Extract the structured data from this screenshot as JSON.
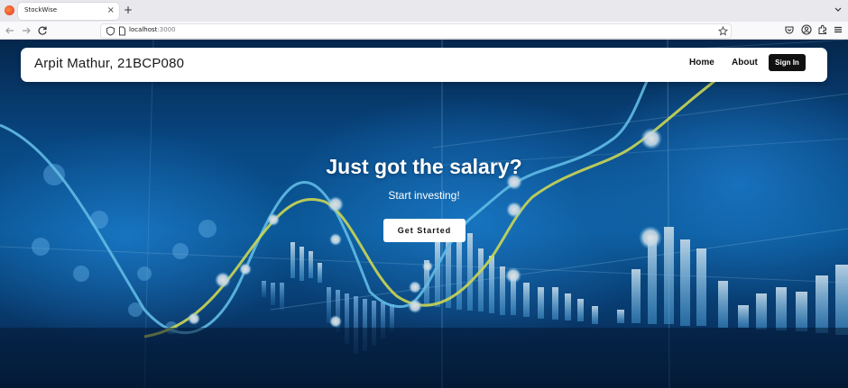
{
  "browser": {
    "tab_title": "StockWise",
    "tab_close": "×",
    "new_tab": "+",
    "url_host": "localhost",
    "url_port": ":3000",
    "icons": [
      "back-icon",
      "forward-icon",
      "reload-icon",
      "shield-icon",
      "page-icon",
      "star-icon",
      "pocket-icon",
      "account-icon",
      "extensions-icon",
      "menu-icon",
      "tab-list-icon"
    ]
  },
  "site": {
    "brand": "Arpit Mathur, 21BCP080",
    "nav": {
      "home": "Home",
      "about": "About",
      "signin": "Sign In"
    },
    "hero": {
      "title": "Just got the salary?",
      "subtitle": "Start investing!",
      "cta": "Get Started"
    }
  },
  "colors": {
    "accent": "#111111",
    "background_blue": "#0b5fa3",
    "line_cyan": "#6fd3ff",
    "line_yellow": "#e8f25a"
  }
}
